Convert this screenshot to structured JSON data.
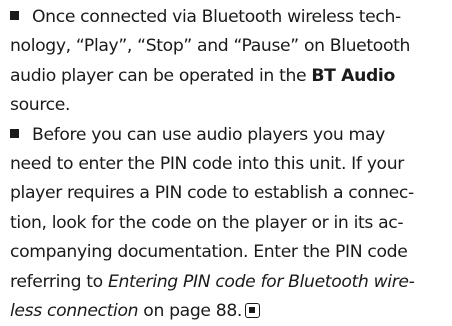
{
  "paragraphs": [
    {
      "lines": [
        {
          "segments": [
            {
              "t": "Once connected via Bluetooth wireless tech-"
            }
          ]
        },
        {
          "segments": [
            {
              "t": "nology, “Play”, “Stop” and “Pause” on Bluetooth"
            }
          ]
        },
        {
          "segments": [
            {
              "t": "audio player can be operated in the "
            },
            {
              "t": "BT Audio",
              "style": "bold"
            }
          ]
        },
        {
          "segments": [
            {
              "t": "source."
            }
          ]
        }
      ]
    },
    {
      "lines": [
        {
          "segments": [
            {
              "t": "Before you can use audio players you may"
            }
          ]
        },
        {
          "segments": [
            {
              "t": "need to enter the PIN code into this unit. If your"
            }
          ]
        },
        {
          "segments": [
            {
              "t": "player requires a PIN code to establish a connec-"
            }
          ]
        },
        {
          "segments": [
            {
              "t": "tion, look for the code on the player or in its ac-"
            }
          ]
        },
        {
          "segments": [
            {
              "t": "companying documentation. Enter the PIN code"
            }
          ]
        },
        {
          "segments": [
            {
              "t": "referring to "
            },
            {
              "t": "Entering PIN code for Bluetooth wire-",
              "style": "italic"
            }
          ]
        },
        {
          "segments": [
            {
              "t": "less connection",
              "style": "italic"
            },
            {
              "t": " on page 88."
            }
          ]
        }
      ]
    }
  ]
}
